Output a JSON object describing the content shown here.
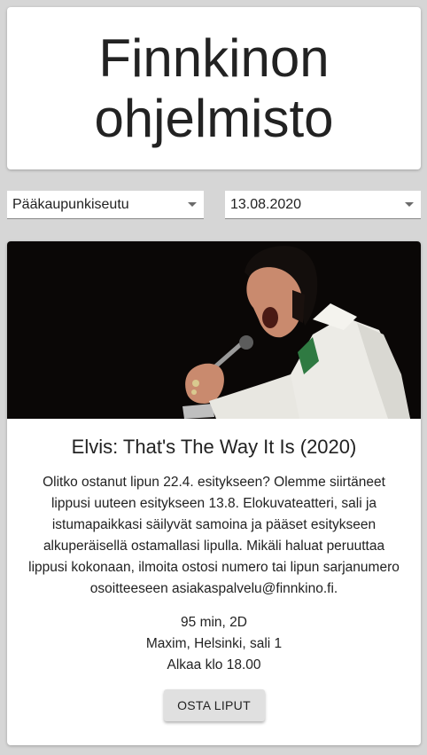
{
  "header": {
    "title": "Finnkinon ohjelmisto"
  },
  "filters": {
    "region": "Pääkaupunkiseutu",
    "date": "13.08.2020"
  },
  "movie": {
    "title": "Elvis: That's The Way It Is (2020)",
    "description": "Olitko ostanut lipun 22.4. esitykseen? Olemme siirtäneet lippusi uuteen esitykseen 13.8. Elokuvateatteri, sali ja istumapaikkasi säilyvät samoina ja pääset esitykseen alkuperäisellä ostamallasi lipulla. Mikäli haluat peruuttaa lippusi kokonaan, ilmoita ostosi numero tai lipun sarjanumero osoitteeseen asiakaspalvelu@finnkino.fi.",
    "details": "95 min, 2D",
    "venue": "Maxim, Helsinki, sali 1",
    "start": "Alkaa klo 18.00",
    "buy_label": "OSTA LIPUT",
    "poster_icon": "elvis-singing-photo"
  }
}
